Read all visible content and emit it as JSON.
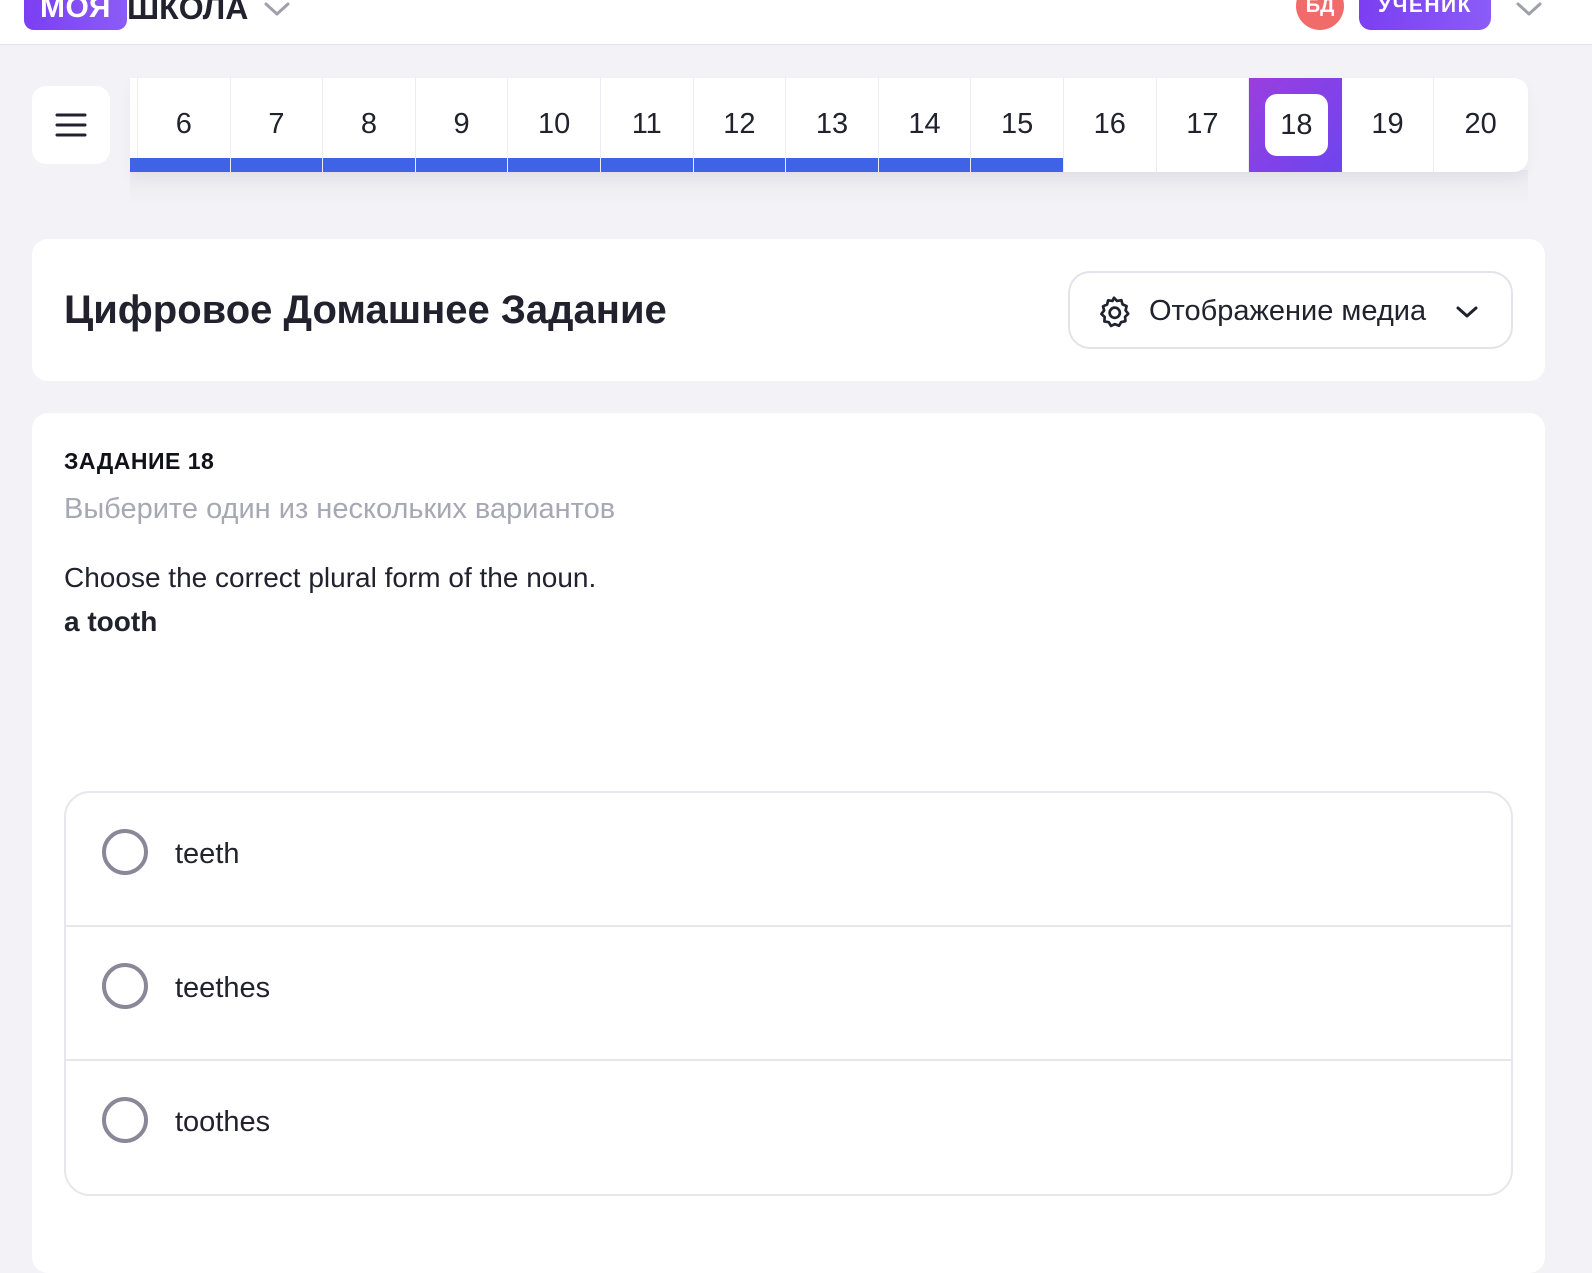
{
  "header": {
    "logo_part1": "МОЯ",
    "logo_part2": "ШКОЛА",
    "avatar_initials": "БД",
    "role_badge": "УЧЕНИК"
  },
  "navigator": {
    "questions": [
      {
        "num": "6",
        "answered": true
      },
      {
        "num": "7",
        "answered": true
      },
      {
        "num": "8",
        "answered": true
      },
      {
        "num": "9",
        "answered": true
      },
      {
        "num": "10",
        "answered": true
      },
      {
        "num": "11",
        "answered": true
      },
      {
        "num": "12",
        "answered": true
      },
      {
        "num": "13",
        "answered": true
      },
      {
        "num": "14",
        "answered": true
      },
      {
        "num": "15",
        "answered": true
      },
      {
        "num": "16",
        "answered": false
      },
      {
        "num": "17",
        "answered": false
      },
      {
        "num": "18",
        "answered": false,
        "current": true
      },
      {
        "num": "19",
        "answered": false
      },
      {
        "num": "20",
        "answered": false
      }
    ]
  },
  "page": {
    "title": "Цифровое Домашнее Задание",
    "media_button": "Отображение медиа"
  },
  "task": {
    "label": "ЗАДАНИЕ 18",
    "hint": "Выберите один из нескольких вариантов",
    "question": "Choose the correct plural form of the noun.",
    "word": "a tooth",
    "options": [
      "teeth",
      "teethes",
      "toothes"
    ]
  },
  "colors": {
    "accent": "#7b3ff2",
    "progress": "#3f63e6",
    "avatar": "#f26b6b"
  }
}
